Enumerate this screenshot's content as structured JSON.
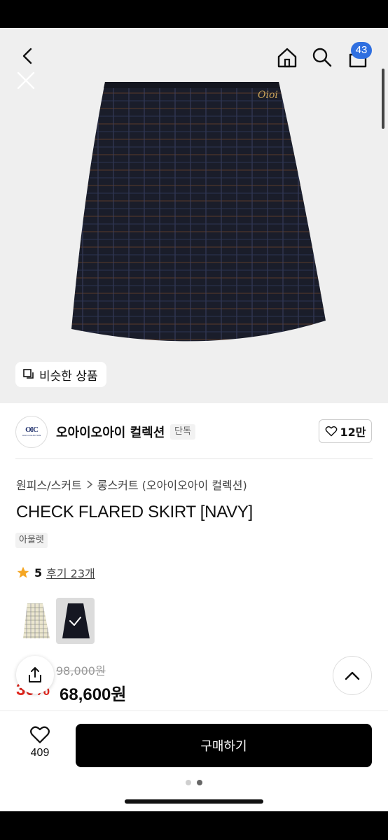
{
  "topbar": {
    "cart_count": "43"
  },
  "hero": {
    "similar_label": "비슷한 상품",
    "logo_script": "Oioi"
  },
  "brand": {
    "name": "오아이오아이 컬렉션",
    "exclusive": "단독",
    "likes": "12만",
    "logo_text": "OIC",
    "logo_sub": "OIOI COLLECTION"
  },
  "product": {
    "breadcrumb": [
      "원피스/스커트",
      "롱스커트 (오아이오아이 컬렉션)"
    ],
    "title": "CHECK FLARED SKIRT [NAVY]",
    "tag": "아울렛",
    "rating": "5",
    "reviews": "후기 23개",
    "original_price": "98,000원",
    "discount": "30%",
    "price": "68,600원"
  },
  "bottom": {
    "wish_count": "409",
    "buy_label": "구매하기"
  },
  "colors": {
    "accent": "#2f6fe0",
    "discount": "#e0241b",
    "navy": "#1b1e2b"
  }
}
